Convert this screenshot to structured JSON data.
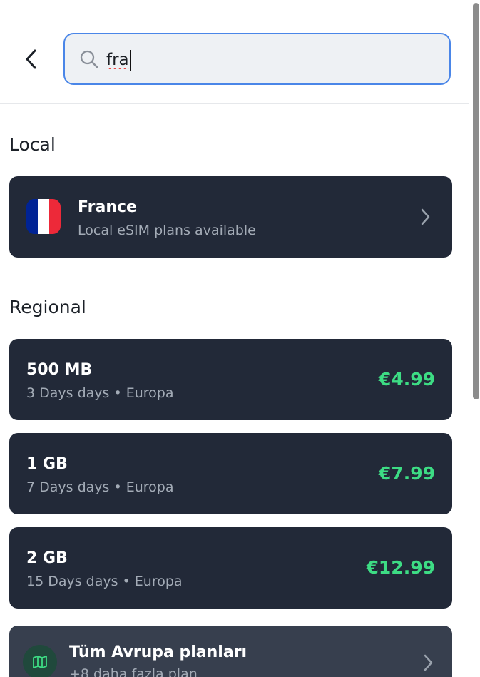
{
  "search": {
    "query": "fra",
    "placeholder": ""
  },
  "local": {
    "title": "Local",
    "item": {
      "name": "France",
      "subtitle": "Local eSIM plans available",
      "flag_colors": [
        "#002395",
        "#ffffff",
        "#ED2939"
      ]
    }
  },
  "regional": {
    "title": "Regional",
    "plans": [
      {
        "data": "500 MB",
        "details": "3 Days days • Europa",
        "price": "€4.99"
      },
      {
        "data": "1 GB",
        "details": "7 Days days • Europa",
        "price": "€7.99"
      },
      {
        "data": "2 GB",
        "details": "15 Days days • Europa",
        "price": "€12.99"
      }
    ],
    "more": {
      "title": "Tüm Avrupa planları",
      "subtitle": "+8 daha fazla plan"
    }
  },
  "colors": {
    "card_bg": "#222938",
    "price": "#3ddc84",
    "accent": "#4a86e8"
  }
}
